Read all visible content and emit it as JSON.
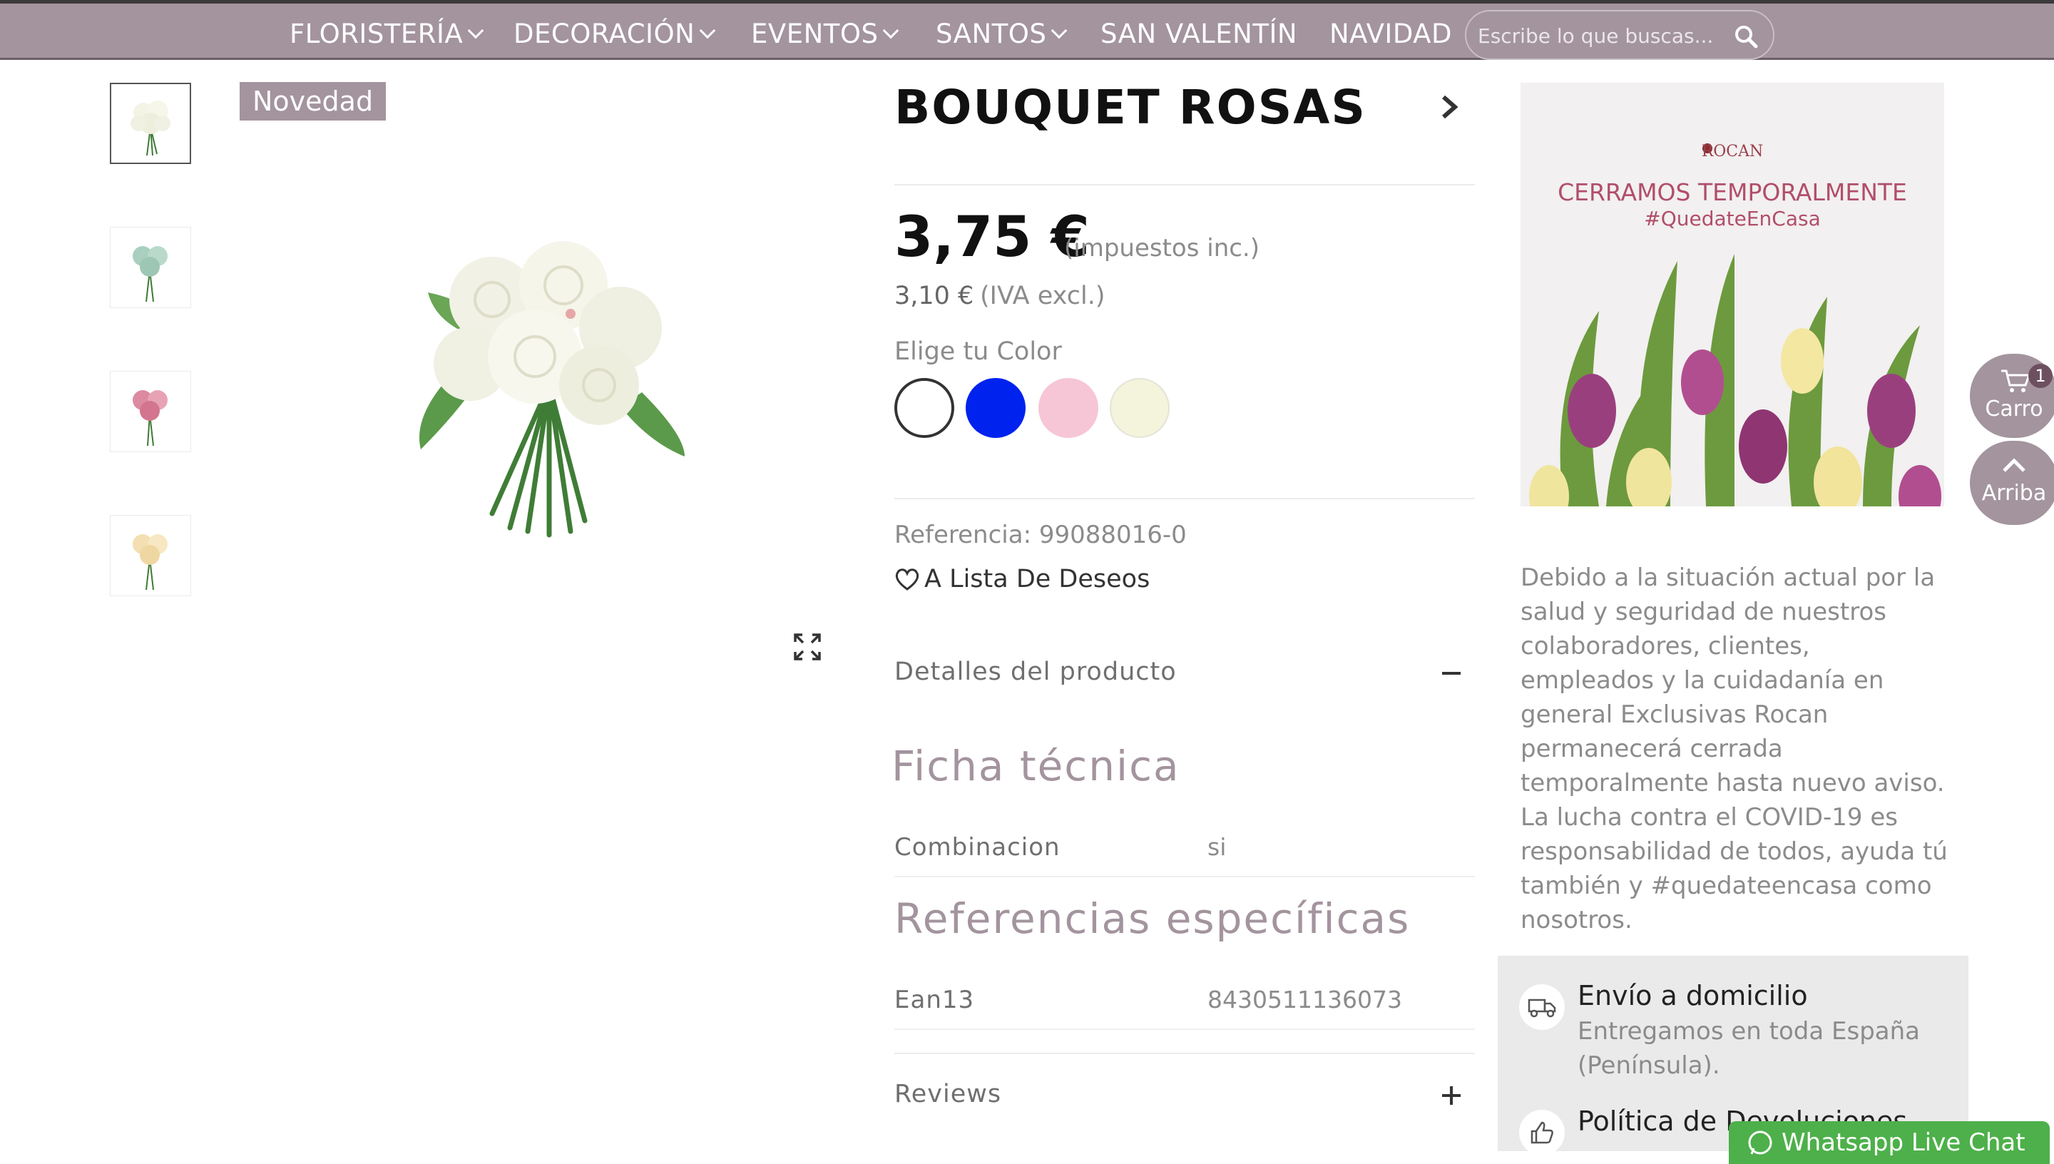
{
  "nav": {
    "items": [
      {
        "label": "FLORISTERÍA",
        "dropdown": true
      },
      {
        "label": "DECORACIÓN",
        "dropdown": true
      },
      {
        "label": "EVENTOS",
        "dropdown": true
      },
      {
        "label": "SANTOS",
        "dropdown": true
      },
      {
        "label": "SAN VALENTÍN",
        "dropdown": false
      },
      {
        "label": "NAVIDAD",
        "dropdown": false
      }
    ],
    "search_placeholder": "Escribe lo que buscas..."
  },
  "gallery": {
    "badge": "Novedad",
    "thumbnails": [
      {
        "color": "white"
      },
      {
        "color": "blue"
      },
      {
        "color": "pink"
      },
      {
        "color": "cream"
      }
    ]
  },
  "product": {
    "title": "BOUQUET ROSAS",
    "price": "3,75 €",
    "tax_note": "(impuestos inc.)",
    "price_excl": "3,10 €",
    "price_excl_note": "(IVA excl.)",
    "color_label": "Elige tu Color",
    "colors": [
      {
        "hex": "#ffffff",
        "selected": true
      },
      {
        "hex": "#0022ee",
        "selected": false
      },
      {
        "hex": "#f6c6d6",
        "selected": false
      },
      {
        "hex": "#f4f3dc",
        "selected": false
      }
    ],
    "reference": "Referencia: 99088016-0",
    "wishlist": "A Lista De Deseos",
    "details_label": "Detalles del producto",
    "tech_sheet_title": "Ficha técnica",
    "combinacion_label": "Combinacion",
    "combinacion_value": "si",
    "specific_refs_title": "Referencias específicas",
    "ean_label": "Ean13",
    "ean_value": "8430511136073",
    "reviews_label": "Reviews"
  },
  "sidebar": {
    "banner_brand": "ROCAN",
    "banner_title": "CERRAMOS TEMPORALMENTE",
    "banner_hashtag": "#QuedateEnCasa",
    "covid_text": "Debido a la situación actual por la salud y seguridad de nuestros colaboradores, clientes, empleados y la cuidadanía en general Exclusivas Rocan permanecerá cerrada temporalmente hasta nuevo aviso. La lucha contra el COVID-19 es responsabilidad de todos, ayuda tú también y #quedateencasa como nosotros.",
    "shipping_title": "Envío a domicilio",
    "shipping_text": "Entregamos en toda España (Península).",
    "returns_title": "Política de Devoluciones"
  },
  "floating": {
    "cart_label": "Carro",
    "cart_count": "1",
    "top_label": "Arriba"
  },
  "chat": {
    "label": "Whatsapp Live Chat"
  },
  "colors": {
    "brand": "#a3949e",
    "chat_green": "#4db04a"
  }
}
